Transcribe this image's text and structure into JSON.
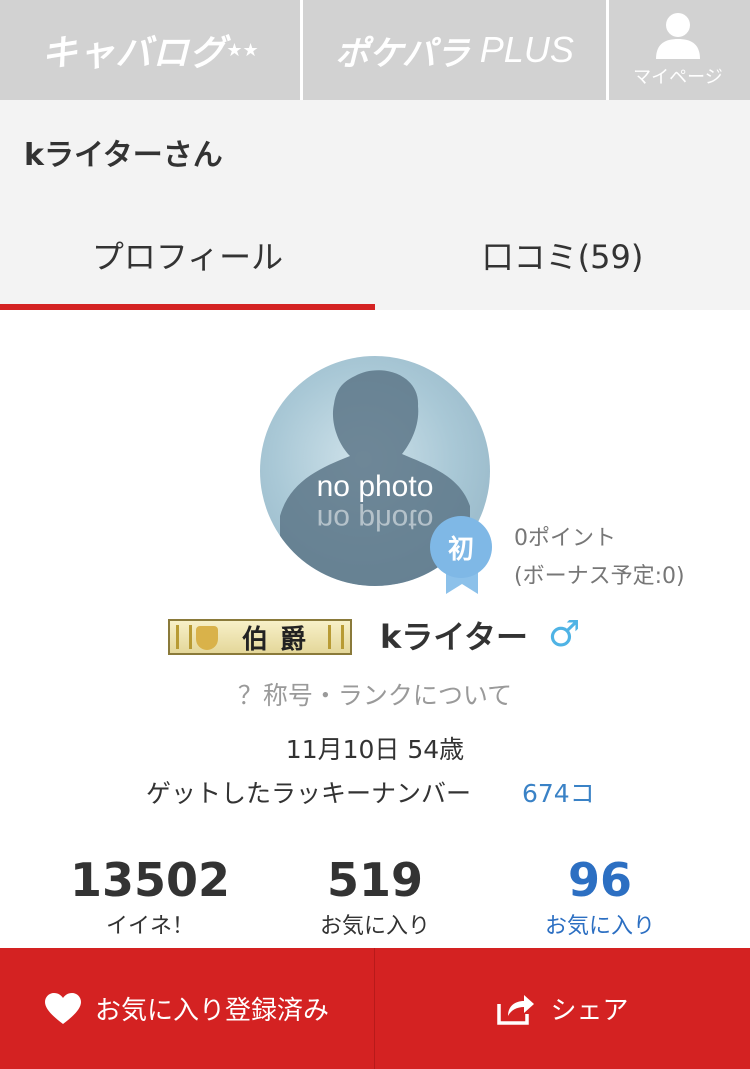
{
  "topnav": {
    "caba_logo": "キャバログ",
    "poke_logo": "ポケパラ",
    "poke_plus": "PLUS",
    "mypage_label": "マイページ"
  },
  "title": {
    "name": "kライターさん"
  },
  "tabs": [
    {
      "label": "プロフィール",
      "active": true
    },
    {
      "label": "口コミ(59)",
      "active": false
    }
  ],
  "profile": {
    "photo_text": "no photo",
    "badge": "初",
    "points": "0ポイント",
    "bonus": "(ボーナス予定:0)",
    "rank": "伯爵",
    "name": "kライター",
    "gender_symbol": "♂",
    "rank_link": "？称号・ランクについて",
    "birth": "11月10日 54歳",
    "lucky_label": "ゲットしたラッキーナンバー",
    "lucky_value": "674コ"
  },
  "stats": [
    {
      "value": "13502",
      "label": "イイネ！"
    },
    {
      "value": "519",
      "label": "お気に入り"
    },
    {
      "value": "96",
      "label": "お気に入り"
    }
  ],
  "bottom": {
    "favorite_label": "お気に入り登録済み",
    "share_label": "シェア"
  },
  "colors": {
    "accent_red": "#d42222",
    "link_blue": "#2c6fc2",
    "nav_gray": "#d2d2d2"
  }
}
